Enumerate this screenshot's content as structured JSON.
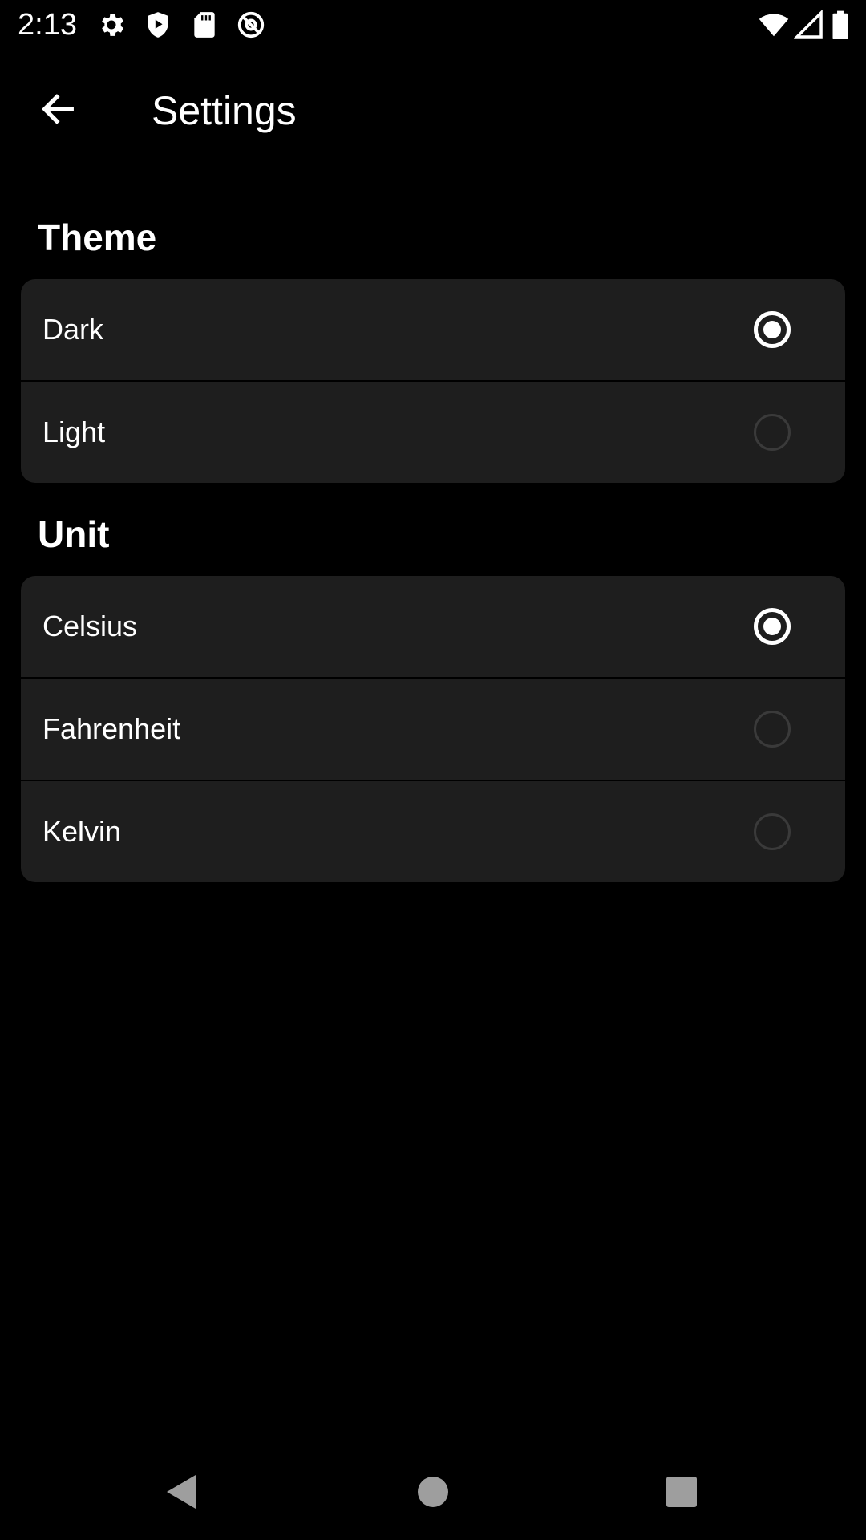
{
  "status_bar": {
    "time": "2:13",
    "left_icons": [
      "gear-icon",
      "shield-play-icon",
      "sd-card-icon",
      "at-sign-icon"
    ],
    "right_icons": [
      "wifi-icon",
      "cellular-signal-icon",
      "battery-icon"
    ]
  },
  "app_bar": {
    "back_icon": "arrow-back-icon",
    "title": "Settings"
  },
  "sections": {
    "theme": {
      "title": "Theme",
      "options": [
        {
          "label": "Dark",
          "selected": true
        },
        {
          "label": "Light",
          "selected": false
        }
      ]
    },
    "unit": {
      "title": "Unit",
      "options": [
        {
          "label": "Celsius",
          "selected": true
        },
        {
          "label": "Fahrenheit",
          "selected": false
        },
        {
          "label": "Kelvin",
          "selected": false
        }
      ]
    }
  },
  "nav_bar": {
    "icons": [
      "back-triangle-icon",
      "home-circle-icon",
      "recents-square-icon"
    ]
  },
  "colors": {
    "background": "#000000",
    "card": "#1e1e1e",
    "text": "#ffffff",
    "radio_unselected": "#3a3a3a",
    "nav_icon": "#9e9e9e"
  }
}
